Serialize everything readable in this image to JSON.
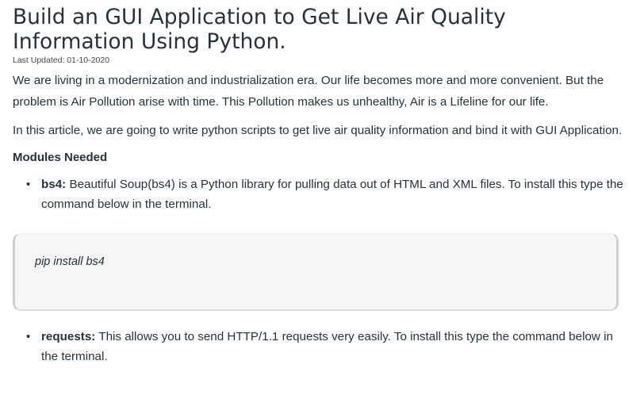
{
  "article": {
    "title": "Build an GUI Application to Get Live Air Quality Information Using Python.",
    "last_updated": "Last Updated: 01-10-2020",
    "paragraphs": [
      "We are living in a modernization and industrialization era. Our life becomes more and more convenient. But the problem is Air Pollution arise with time. This Pollution makes us unhealthy, Air is a Lifeline for our life.",
      "In this article, we are going to write python scripts to get live air quality information and bind it with GUI Application."
    ],
    "modules_heading": "Modules Needed",
    "modules": [
      {
        "name": "bs4:",
        "description": " Beautiful Soup(bs4) is a Python library for pulling data out of HTML and XML files. To install this type the command below in the terminal."
      },
      {
        "name": "requests:",
        "description": " This allows you to send HTTP/1.1 requests very easily. To install this type the command below in the terminal."
      }
    ],
    "code_snippet": "pip install bs4",
    "bullet": "•"
  }
}
